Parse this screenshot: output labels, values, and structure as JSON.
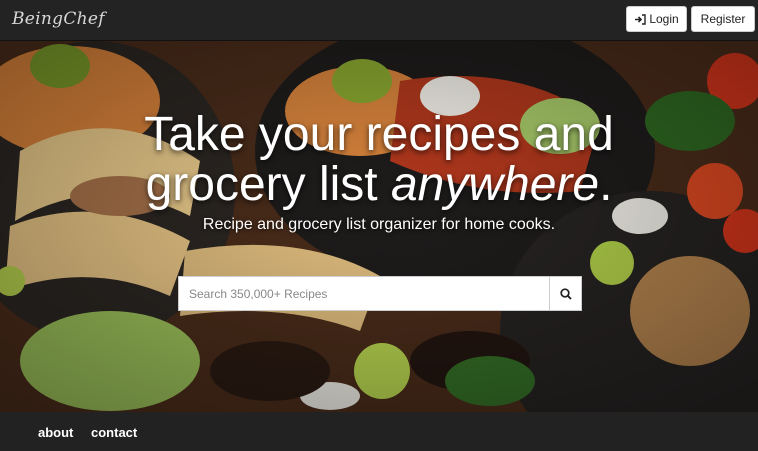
{
  "navbar": {
    "brand": "BeingChef",
    "login_label": "Login",
    "register_label": "Register"
  },
  "hero": {
    "title_line1": "Take your recipes and",
    "title_line2_prefix": "grocery list ",
    "title_line2_emphasis": "anywhere",
    "title_line2_suffix": ".",
    "subtitle": "Recipe and grocery list organizer for home cooks."
  },
  "search": {
    "placeholder": "Search 350,000+ Recipes",
    "value": ""
  },
  "footer": {
    "links": [
      "about",
      "contact"
    ]
  },
  "icons": {
    "login": "login-icon",
    "search": "search-icon"
  },
  "colors": {
    "navbar_bg": "#232323",
    "footer_bg": "#222222",
    "hero_text": "#ffffff"
  }
}
